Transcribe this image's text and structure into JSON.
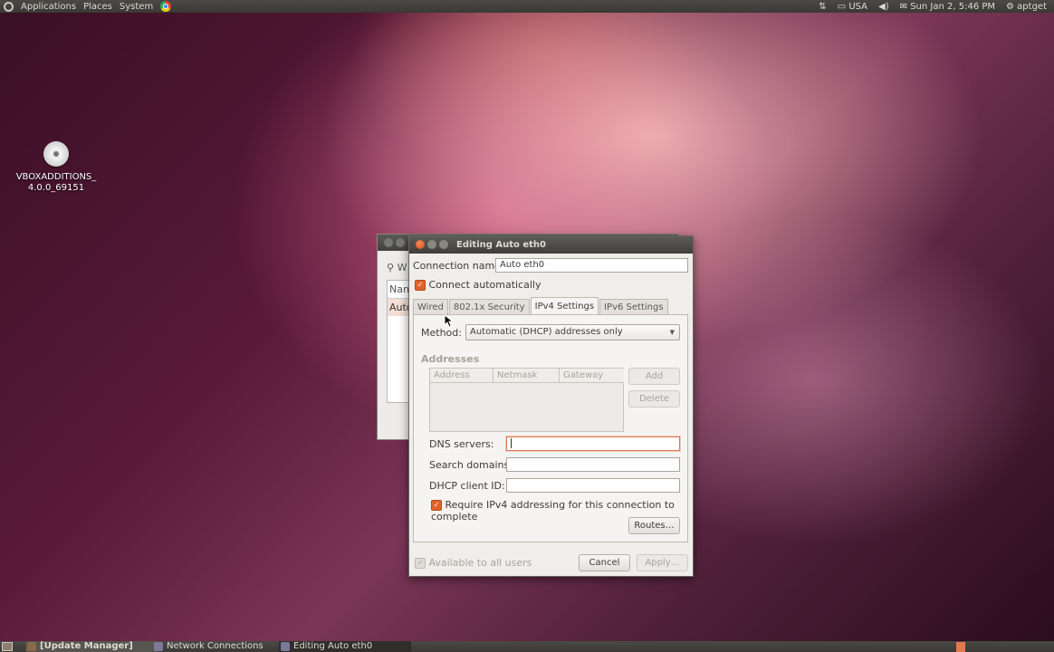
{
  "top_panel": {
    "menus": [
      "Applications",
      "Places",
      "System"
    ],
    "keyboard_layout": "USA",
    "clock": "Sun Jan 2,  5:46 PM",
    "user": "aptget"
  },
  "desktop_icon": {
    "label_line1": "VBOXADDITIONS_",
    "label_line2": "4.0.0_69151"
  },
  "background_window": {
    "partial_tab": "W",
    "partial_col": "Nan",
    "partial_row": "Auto"
  },
  "dialog": {
    "title": "Editing Auto eth0",
    "connection_name_label": "Connection name:",
    "connection_name_value": "Auto eth0",
    "connect_auto_label": "Connect automatically",
    "tabs": [
      "Wired",
      "802.1x Security",
      "IPv4 Settings",
      "IPv6 Settings"
    ],
    "active_tab": "IPv4 Settings",
    "method_label": "Method:",
    "method_value": "Automatic (DHCP) addresses only",
    "addresses_label": "Addresses",
    "address_columns": [
      "Address",
      "Netmask",
      "Gateway"
    ],
    "add_button": "Add",
    "delete_button": "Delete",
    "dns_label": "DNS servers:",
    "dns_value": "",
    "search_domains_label": "Search domains:",
    "search_domains_value": "",
    "dhcp_client_id_label": "DHCP client ID:",
    "dhcp_client_id_value": "",
    "require_ipv4_label": "Require IPv4 addressing for this connection to complete",
    "routes_button": "Routes…",
    "available_all_users_label": "Available to all users",
    "cancel_button": "Cancel",
    "apply_button": "Apply…"
  },
  "taskbar": {
    "items": [
      "[Update Manager]",
      "Network Connections",
      "Editing Auto eth0"
    ]
  }
}
